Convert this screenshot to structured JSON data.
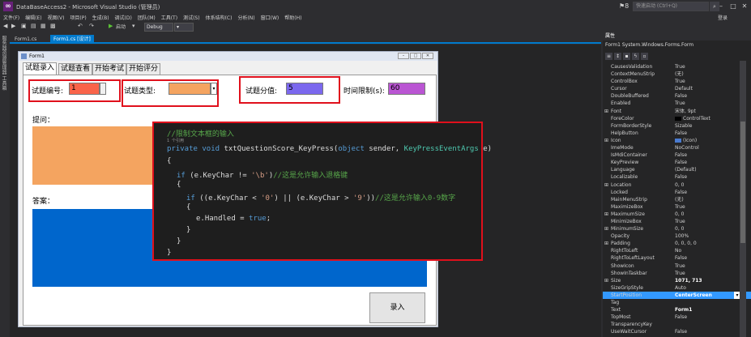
{
  "window": {
    "title": "DataBaseAccess2 - Microsoft Visual Studio (管理员)",
    "notifications": "8",
    "quick_launch_placeholder": "快速启动 (Ctrl+Q)",
    "login": "登录"
  },
  "menu": [
    "文件(F)",
    "编辑(E)",
    "视图(V)",
    "项目(P)",
    "生成(B)",
    "调试(D)",
    "团队(M)",
    "工具(T)",
    "测试(S)",
    "体系结构(C)",
    "分析(N)",
    "窗口(W)",
    "帮助(H)"
  ],
  "toolbar": {
    "start_label": "启动",
    "config": "Debug"
  },
  "sidebar": {
    "label": "服务器资源管理器 工具箱"
  },
  "doc_tabs": [
    {
      "label": "Form1.cs"
    },
    {
      "label": "Form1.cs [设计]"
    }
  ],
  "form": {
    "title": "Form1",
    "tabs": [
      "试题录入",
      "试题查看",
      "开始考试",
      "开始评分"
    ],
    "id_label": "试题编号:",
    "id_value": "1",
    "type_label": "试题类型:",
    "score_label": "试题分值:",
    "score_value": "5",
    "time_label": "时间限制(s):",
    "time_value": "60",
    "question_label": "提问：",
    "answer_label": "答案：",
    "submit_label": "录入",
    "colors": {
      "id": "#f9644a",
      "type": "#f4a460",
      "score": "#7b68ee",
      "time": "#ba55d3",
      "question": "#f4a460",
      "answer": "#0066cc"
    }
  },
  "code": {
    "comment_title": "//限制文本框的输入",
    "refs": "1 个引用",
    "line_private": "private",
    "line_void": "void",
    "line_method": " txtQuestionScore_KeyPress(",
    "line_object": "object",
    "line_sender": " sender, ",
    "line_type": "KeyPressEventArgs",
    "line_e": " e)",
    "brace_open": "{",
    "if1_pre": "if",
    "if1_mid": " (e.KeyChar != ",
    "if1_char": "'\\b'",
    "if1_post": ")",
    "if1_comment": "//这是允许输入退格键",
    "if2_pre": "if",
    "if2_mid": " ((e.KeyChar < ",
    "if2_c1": "'0'",
    "if2_mid2": ") || (e.KeyChar > ",
    "if2_c2": "'9'",
    "if2_post": "))",
    "if2_comment": "//这是允许输入0-9数字",
    "handled_pre": "e.Handled = ",
    "handled_val": "true",
    "handled_post": ";",
    "brace_close": "}"
  },
  "properties": {
    "header": "属性",
    "object": "Form1  System.Windows.Forms.Form",
    "rows": [
      {
        "name": "CausesValidation",
        "value": "True"
      },
      {
        "name": "ContextMenuStrip",
        "value": "(无)"
      },
      {
        "name": "ControlBox",
        "value": "True"
      },
      {
        "name": "Cursor",
        "value": "Default"
      },
      {
        "name": "DoubleBuffered",
        "value": "False"
      },
      {
        "name": "Enabled",
        "value": "True"
      },
      {
        "name": "Font",
        "value": "宋体, 9pt"
      },
      {
        "name": "ForeColor",
        "value": "ControlText"
      },
      {
        "name": "FormBorderStyle",
        "value": "Sizable"
      },
      {
        "name": "HelpButton",
        "value": "False"
      },
      {
        "name": "Icon",
        "value": "(Icon)"
      },
      {
        "name": "ImeMode",
        "value": "NoControl"
      },
      {
        "name": "IsMdiContainer",
        "value": "False"
      },
      {
        "name": "KeyPreview",
        "value": "False"
      },
      {
        "name": "Language",
        "value": "(Default)"
      },
      {
        "name": "Localizable",
        "value": "False"
      },
      {
        "name": "Location",
        "value": "0, 0"
      },
      {
        "name": "Locked",
        "value": "False"
      },
      {
        "name": "MainMenuStrip",
        "value": "(无)"
      },
      {
        "name": "MaximizeBox",
        "value": "True"
      },
      {
        "name": "MaximumSize",
        "value": "0, 0"
      },
      {
        "name": "MinimizeBox",
        "value": "True"
      },
      {
        "name": "MinimumSize",
        "value": "0, 0"
      },
      {
        "name": "Opacity",
        "value": "100%"
      },
      {
        "name": "Padding",
        "value": "0, 0, 0, 0"
      },
      {
        "name": "RightToLeft",
        "value": "No"
      },
      {
        "name": "RightToLeftLayout",
        "value": "False"
      },
      {
        "name": "ShowIcon",
        "value": "True"
      },
      {
        "name": "ShowInTaskbar",
        "value": "True"
      },
      {
        "name": "Size",
        "value": "1071, 713"
      },
      {
        "name": "SizeGripStyle",
        "value": "Auto"
      },
      {
        "name": "StartPosition",
        "value": "CenterScreen"
      },
      {
        "name": "Tag",
        "value": ""
      },
      {
        "name": "Text",
        "value": "Form1"
      },
      {
        "name": "TopMost",
        "value": "False"
      },
      {
        "name": "TransparencyKey",
        "value": ""
      },
      {
        "name": "UseWaitCursor",
        "value": "False"
      }
    ]
  }
}
